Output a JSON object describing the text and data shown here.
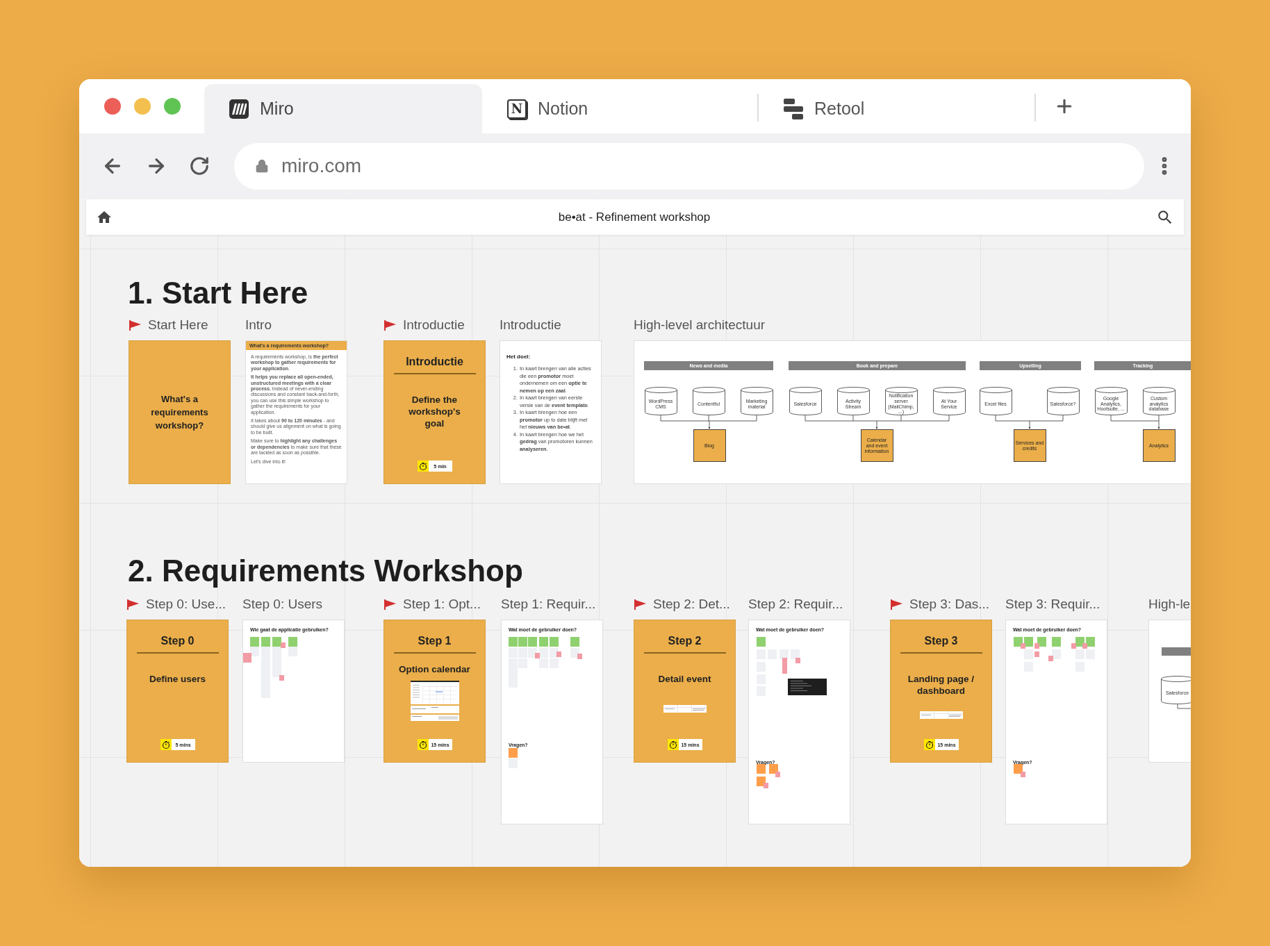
{
  "browser": {
    "tabs": [
      {
        "label": "Miro",
        "kind": "miro",
        "selected": true
      },
      {
        "label": "Notion",
        "kind": "notion",
        "logo_letter": "N",
        "selected": false
      },
      {
        "label": "Retool",
        "kind": "retool",
        "selected": false
      }
    ],
    "address": "miro.com"
  },
  "board": {
    "title": "be•at - Refinement workshop"
  },
  "sections": [
    {
      "title": "1. Start Here",
      "frames": [
        {
          "kind": "cover",
          "label": "Start Here",
          "flagged": true,
          "text": "What's a requirements workshop?"
        },
        {
          "kind": "doc",
          "label": "Intro",
          "flagged": false,
          "heading": "What's a requirements workshop?",
          "paragraphs": [
            "A requirements workshop, is **the perfect workshop to gather requirements for your application**.",
            "**It helps you replace all open-ended, unstructured meetings with a clear process.** Instead of never-ending discussions and constant back-and-forth, you can use this simple workshop to gather the requirements for your application.",
            "It takes about **90 to 120 minutes** - and should give us alignment on what is going to be built.",
            "Make sure to **highlight any challenges or dependencies** to make sure that these are tackled as soon as possible.",
            "Let's dive into it!"
          ]
        },
        {
          "kind": "step",
          "label": "Introductie",
          "flagged": true,
          "title": "Introductie",
          "subtitle": "Define the workshop's goal",
          "timer": "5 min"
        },
        {
          "kind": "list",
          "label": "Introductie",
          "flagged": false,
          "heading": "Het doel:",
          "items": [
            {
              "number": "1.",
              "text": "In kaart brengen van alle acties die een **promotor** moet ondernemen om een **optie te nemen op een zaal**."
            },
            {
              "number": "2.",
              "text": "In kaart brengen van eerste versie van de **event template**."
            },
            {
              "number": "3.",
              "text": "In kaart brengen hoe een **promotor** up to date blijft met het **nieuws van be•at**."
            },
            {
              "number": "4.",
              "text": "In kaart brengen hoe we het **gedrag** van promotoren kunnen **analyseren**."
            }
          ]
        },
        {
          "kind": "architecture",
          "label": "High-level architectuur",
          "flagged": false,
          "groups": [
            {
              "name": "News and media",
              "sources": [
                "WordPress CMS",
                "Contentful",
                "Marketing material"
              ],
              "target": "Blog"
            },
            {
              "name": "Book and prepare",
              "sources": [
                "Salesforce",
                "Activity Stream",
                "Notification server (MailChimp, ...)",
                "At Your Service"
              ],
              "target": "Calendar and event information"
            },
            {
              "name": "Upselling",
              "sources": [
                "Excel files",
                "Salesforce?"
              ],
              "target": "Services and credits"
            },
            {
              "name": "Tracking",
              "sources": [
                "Google Analytics, Hootsuite, ...",
                "Custom analytics database"
              ],
              "target": "Analytics"
            }
          ]
        }
      ]
    },
    {
      "title": "2. Requirements Workshop",
      "frames": [
        {
          "kind": "step",
          "label": "Step 0: Use...",
          "flagged": true,
          "title": "Step 0",
          "subtitle": "Define users",
          "timer": "5 mins"
        },
        {
          "kind": "board",
          "label": "Step 0: Users",
          "flagged": false,
          "heading": "Wie gaat de applicatie gebruiken?"
        },
        {
          "kind": "step",
          "label": "Step 1: Opt...",
          "flagged": true,
          "title": "Step 1",
          "subtitle": "Option calendar",
          "preview": {
            "kind": "calendar"
          },
          "timer": "15 mins"
        },
        {
          "kind": "board",
          "label": "Step 1: Requir...",
          "flagged": false,
          "heading": "Wat moet de gebruiker doen?",
          "questions": "Vragen?"
        },
        {
          "kind": "step",
          "label": "Step 2: Det...",
          "flagged": true,
          "title": "Step 2",
          "subtitle": "Detail event",
          "preview": {
            "kind": "table"
          },
          "timer": "15 mins"
        },
        {
          "kind": "board",
          "label": "Step 2: Requir...",
          "flagged": false,
          "heading": "Wat moet de gebruiker doen?",
          "questions": "Vragen?"
        },
        {
          "kind": "step",
          "label": "Step 3: Das...",
          "flagged": true,
          "title": "Step 3",
          "subtitle": "Landing page / dashboard",
          "preview": {
            "kind": "table"
          },
          "timer": "15 mins"
        },
        {
          "kind": "board",
          "label": "Step 3: Requir...",
          "flagged": false,
          "heading": "Wat moet de gebruiker doen?",
          "questions": "Vragen?"
        },
        {
          "kind": "snippet",
          "label": "High-le",
          "flagged": false,
          "node": "Salesforce"
        }
      ]
    }
  ]
}
